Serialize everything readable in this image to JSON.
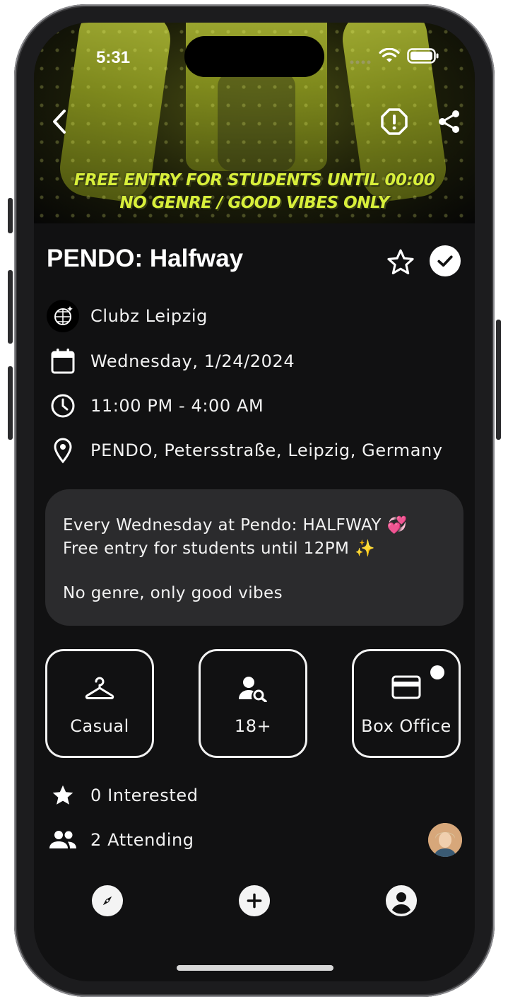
{
  "status_bar": {
    "time": "5:31"
  },
  "hero": {
    "promo_line1": "FREE ENTRY FOR STUDENTS UNTIL 00:00",
    "promo_line2": "NO GENRE / GOOD VIBES ONLY"
  },
  "header_actions": {
    "icons": [
      "chevron-left-icon",
      "report-icon",
      "share-icon"
    ]
  },
  "event": {
    "title": "PENDO: Halfway",
    "organizer": "Clubz Leipzig",
    "date": "Wednesday, 1/24/2024",
    "time_range": "11:00 PM - 4:00 AM",
    "location": "PENDO, Petersstraße, Leipzig, Germany"
  },
  "description": {
    "line1": "Every Wednesday at Pendo: HALFWAY 💞",
    "line2": "Free entry for students until 12PM ✨",
    "line3": "No genre, only good vibes"
  },
  "tiles": [
    {
      "label": "Casual",
      "icon": "hanger-icon"
    },
    {
      "label": "18+",
      "icon": "person-search-icon"
    },
    {
      "label": "Box Office",
      "icon": "credit-card-icon"
    }
  ],
  "stats": {
    "interested": "0 Interested",
    "attending": "2 Attending"
  },
  "bottom_nav": {
    "icons": [
      "compass-icon",
      "add-icon",
      "account-icon"
    ]
  },
  "colors": {
    "background": "#111112",
    "card": "#2b2b2d",
    "promo_text": "#d8ef3a"
  }
}
